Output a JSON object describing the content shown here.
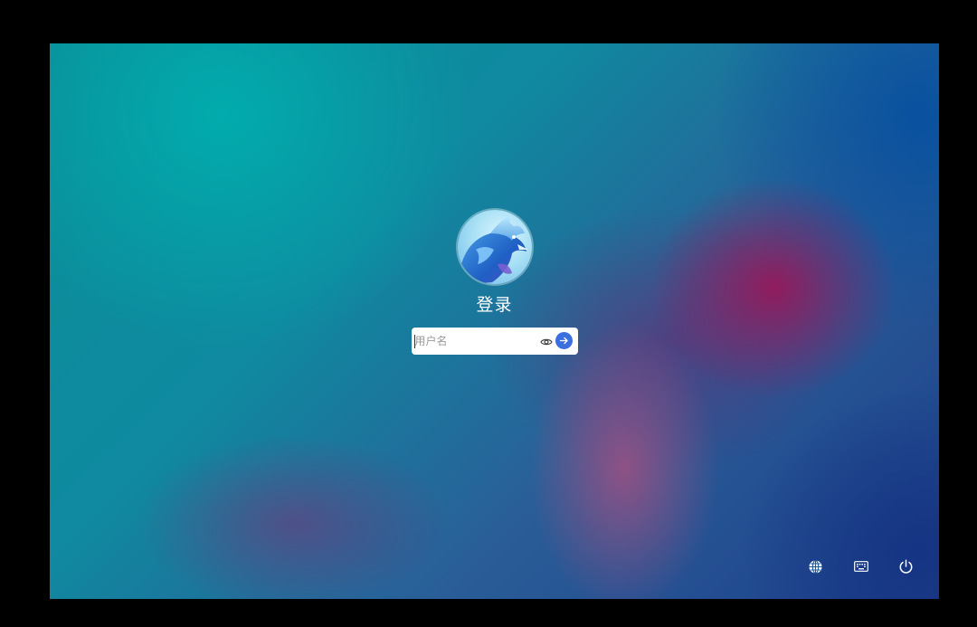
{
  "login": {
    "title": "登录",
    "username_placeholder": "用户名",
    "username_value": ""
  },
  "icons": {
    "avatar": "dragon-avatar-icon",
    "password_toggle": "eye-icon",
    "submit": "arrow-right-icon",
    "language": "globe-icon",
    "keyboard": "keyboard-icon",
    "power": "power-icon"
  },
  "colors": {
    "accent": "#3b6fe0",
    "text": "#ffffff"
  }
}
